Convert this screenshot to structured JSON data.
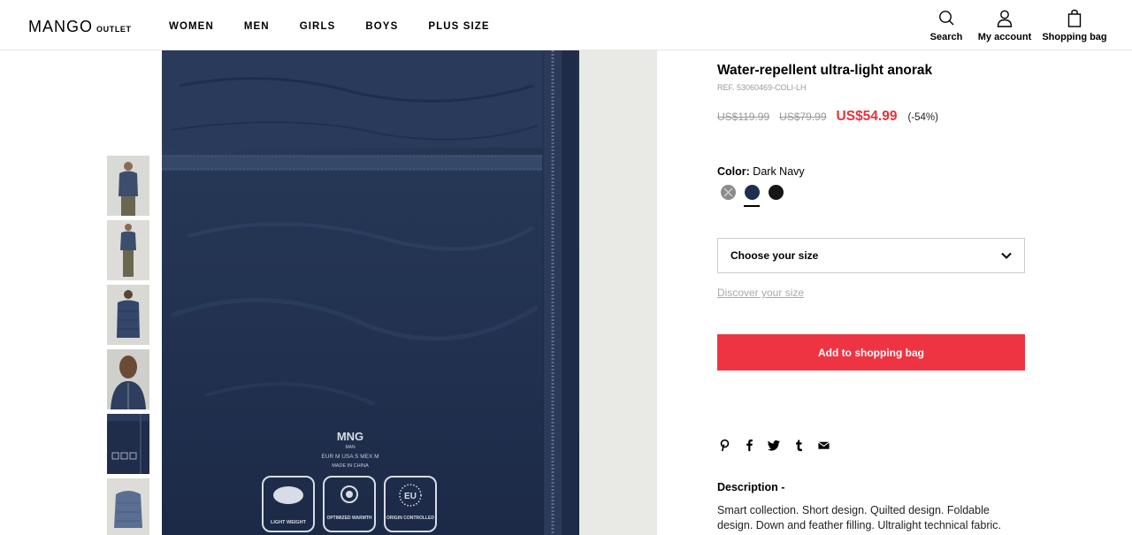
{
  "header": {
    "logo": "MANGO",
    "logo_sub": "OUTLET",
    "nav": [
      "WOMEN",
      "MEN",
      "GIRLS",
      "BOYS",
      "PLUS SIZE"
    ],
    "search_label": "Search",
    "account_label": "My account",
    "bag_label": "Shopping bag"
  },
  "gallery": {
    "thumbnail_count": 6,
    "label": {
      "brand": "MNG",
      "line": "MAN",
      "sizes": "EUR M   USA S   MEX M",
      "origin": "MADE IN CHINA",
      "badges": [
        "LIGHT WEIGHT",
        "OPTIMIZED WARMTH",
        "ORIGIN CONTROLLED"
      ],
      "eu_mark": "EU"
    }
  },
  "product": {
    "title": "Water-repellent ultra-light anorak",
    "ref": "REF. 53060469-COLI-LH",
    "price_original": "US$119.99",
    "price_previous": "US$79.99",
    "price_current": "US$54.99",
    "discount": "(-54%)",
    "color_label": "Color:",
    "color_value": "Dark Navy",
    "swatches": [
      {
        "name": "Grey",
        "color": "#8a8a8a",
        "available": false
      },
      {
        "name": "Dark Navy",
        "color": "#1f2f4f",
        "selected": true
      },
      {
        "name": "Black",
        "color": "#161616"
      }
    ],
    "size_placeholder": "Choose your size",
    "discover_size": "Discover your size",
    "add_to_bag": "Add to shopping bag",
    "share_icons": [
      "pinterest-icon",
      "facebook-icon",
      "twitter-icon",
      "tumblr-icon",
      "email-icon"
    ],
    "description_title": "Description -",
    "description": "Smart collection. Short design. Quilted design. Foldable design. Down and feather filling. Ultralight technical fabric."
  },
  "colors": {
    "accent_red": "#ee3442",
    "price_red": "#e8303c",
    "navy": "#1f2f4f"
  }
}
